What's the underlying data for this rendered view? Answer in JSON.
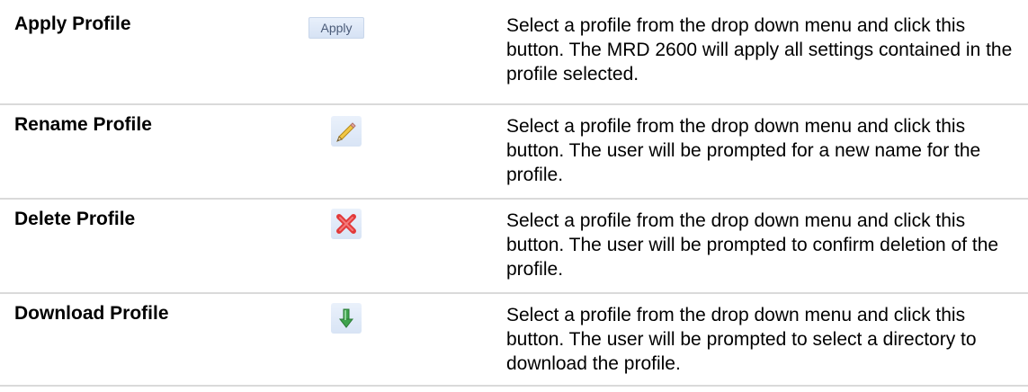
{
  "rows": [
    {
      "name": "Apply Profile",
      "button_label": "Apply",
      "description": "Select a profile from the drop down menu and click this button. The MRD 2600 will apply all settings contained in the profile selected."
    },
    {
      "name": "Rename Profile",
      "icon": "pencil-icon",
      "description": "Select a profile from the drop down menu and click this button. The user will be prompted for a new name for the profile."
    },
    {
      "name": "Delete Profile",
      "icon": "red-x-delete-icon",
      "description": "Select a profile from the drop down menu and click this button. The user will be prompted to confirm deletion of the profile."
    },
    {
      "name": "Download Profile",
      "icon": "green-down-arrow-icon",
      "description": "Select a profile from the drop down menu and click this button. The user will be prompted to select a directory to download the profile."
    }
  ],
  "colors": {
    "row_border": "#dadada",
    "button_bg": "#d8e4f5",
    "delete_red": "#e23a3a",
    "download_green": "#3fa34d",
    "pencil_yellow": "#f2c744"
  }
}
